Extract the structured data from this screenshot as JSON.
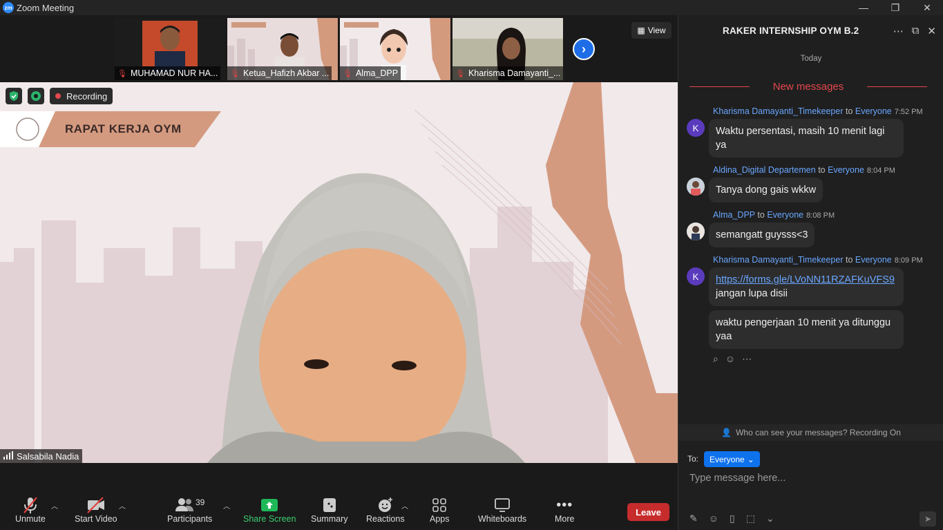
{
  "window": {
    "title": "Zoom Meeting",
    "minimize": "—",
    "maximize": "❐",
    "close": "✕"
  },
  "thumbnails": [
    {
      "name": "MUHAMAD NUR HA..."
    },
    {
      "name": "Ketua_Hafizh Akbar ..."
    },
    {
      "name": "Alma_DPP"
    },
    {
      "name": "Kharisma Damayanti_..."
    }
  ],
  "view_button": "View",
  "main_video": {
    "recording_label": "Recording",
    "banner_title": "RAPAT KERJA OYM",
    "speaker_name": "Salsabila Nadia"
  },
  "toolbar": {
    "unmute": "Unmute",
    "start_video": "Start Video",
    "participants": "Participants",
    "participants_count": "39",
    "share_screen": "Share Screen",
    "summary": "Summary",
    "reactions": "Reactions",
    "apps": "Apps",
    "whiteboards": "Whiteboards",
    "more": "More",
    "leave": "Leave"
  },
  "chat": {
    "title": "RAKER INTERNSHIP OYM B.2",
    "day": "Today",
    "new_messages": "New messages",
    "messages": [
      {
        "sender": "Kharisma Damayanti_Timekeeper",
        "to": "to",
        "recipient": "Everyone",
        "time": "7:52 PM",
        "text": " Waktu persentasi, masih 10 menit lagi ya",
        "avatar": "K"
      },
      {
        "sender": "Aldina_Digital Departemen",
        "to": "to",
        "recipient": "Everyone",
        "time": "8:04 PM",
        "text": "Tanya dong gais wkkw"
      },
      {
        "sender": "Alma_DPP",
        "to": "to",
        "recipient": "Everyone",
        "time": "8:08 PM",
        "text": "semangatt guysss<3"
      },
      {
        "sender": "Kharisma Damayanti_Timekeeper",
        "to": "to",
        "recipient": "Everyone",
        "time": "8:09 PM",
        "link": "https://forms.gle/LVoNN11RZAFKuVFS9",
        "text": "jangan lupa disii",
        "avatar": "K"
      },
      {
        "text": "waktu pengerjaan 10 menit ya ditunggu yaa"
      }
    ],
    "who_can_see": "Who can see your messages? Recording On",
    "to_label": "To:",
    "to_value": "Everyone",
    "input_placeholder": "Type message here..."
  }
}
